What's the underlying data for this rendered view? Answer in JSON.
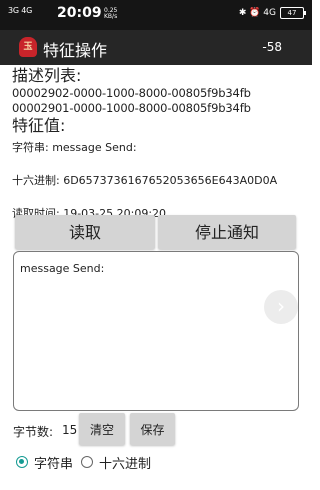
{
  "status_bar": {
    "network": "3G 4G",
    "time": "20:09",
    "speed": "0.25\nKB/s",
    "icons": "✱ ⏰ 4G",
    "battery": "47"
  },
  "app_bar": {
    "icon_text": "玉",
    "title": "特征操作",
    "rssi": "-58"
  },
  "descriptor": {
    "heading": "描述列表:",
    "uuids": [
      "00002902-0000-1000-8000-00805f9b34fb",
      "00002901-0000-1000-8000-00805f9b34fb"
    ]
  },
  "characteristic": {
    "heading": "特征值:",
    "string_value": "字符串: message Send:",
    "hex_value": "十六进制: 6D6573736167652053656E643A0D0A",
    "read_time": "读取时间: 19-03-25 20:09:20"
  },
  "buttons": {
    "read": "读取",
    "stop_notify": "停止通知",
    "clear": "清空",
    "save": "保存"
  },
  "log": {
    "text": "message Send:"
  },
  "scroll_icon": "›",
  "bytes": {
    "label": "字节数:",
    "count": "15"
  },
  "mode": {
    "options": [
      "字符串",
      "十六进制"
    ],
    "selected": "字符串"
  },
  "colors": {
    "accent": "#159b93",
    "app_bar": "#262626"
  }
}
